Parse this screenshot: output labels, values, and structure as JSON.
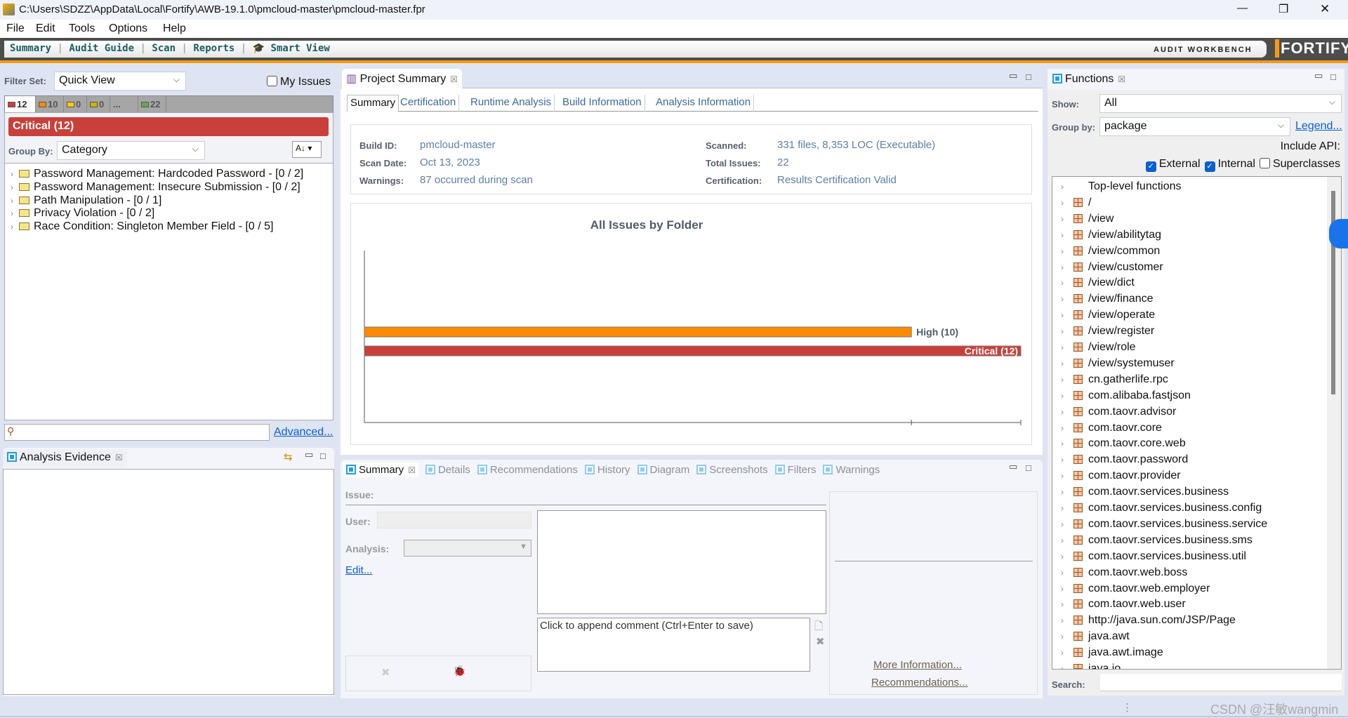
{
  "window": {
    "title": "C:\\Users\\SDZZ\\AppData\\Local\\Fortify\\AWB-19.1.0\\pmcloud-master\\pmcloud-master.fpr",
    "minimize": "—",
    "restore": "❐",
    "close": "✕"
  },
  "menu": [
    "File",
    "Edit",
    "Tools",
    "Options",
    "Help"
  ],
  "toolbar": {
    "items": [
      "Summary",
      "Audit Guide",
      "Scan",
      "Reports",
      "Smart View"
    ],
    "brand_text": "AUDIT WORKBENCH",
    "logo": "FORTIFY"
  },
  "left": {
    "filter_set_label": "Filter Set:",
    "filter_set_value": "Quick View",
    "my_issues": "My Issues",
    "severity_tabs": [
      {
        "count": "12",
        "color": "#c9403a"
      },
      {
        "count": "10",
        "color": "#ff8a00"
      },
      {
        "count": "0",
        "color": "#ffcc00"
      },
      {
        "count": "0",
        "color": "#d4b000"
      },
      {
        "count": "...",
        "color": ""
      },
      {
        "count": "22",
        "color": "#6aa84f"
      }
    ],
    "critical_label": "Critical (12)",
    "group_by_label": "Group By:",
    "group_by_value": "Category",
    "tree": [
      "Password Management: Hardcoded Password - [0 / 2]",
      "Password Management: Insecure Submission - [0 / 2]",
      "Path Manipulation - [0 / 1]",
      "Privacy Violation - [0 / 2]",
      "Race Condition: Singleton Member Field - [0 / 5]"
    ],
    "search_value": "",
    "advanced": "Advanced...",
    "evidence_title": "Analysis Evidence"
  },
  "project": {
    "tab_title": "Project Summary",
    "subtabs": [
      "Summary",
      "Certification",
      "Runtime Analysis",
      "Build Information",
      "Analysis Information"
    ],
    "info": {
      "build_id_label": "Build ID:",
      "build_id": "pmcloud-master",
      "scan_date_label": "Scan Date:",
      "scan_date": "Oct 13, 2023",
      "warnings_label": "Warnings:",
      "warnings": "87 occurred during scan",
      "scanned_label": "Scanned:",
      "scanned": "331 files, 8,353 LOC (Executable)",
      "total_label": "Total Issues:",
      "total": "22",
      "cert_label": "Certification:",
      "cert": "Results Certification Valid"
    }
  },
  "chart_data": {
    "type": "bar",
    "orientation": "horizontal",
    "title": "All Issues by Folder",
    "categories": [
      "High",
      "Critical"
    ],
    "values": [
      10,
      12
    ],
    "labels": [
      "High (10)",
      "Critical (12)"
    ],
    "colors": [
      "#ff8a00",
      "#c9403a"
    ],
    "xlim": [
      0,
      12
    ],
    "xticks": [
      10,
      12
    ],
    "grid": false,
    "legend": "none"
  },
  "issue": {
    "tabs": [
      "Summary",
      "Details",
      "Recommendations",
      "History",
      "Diagram",
      "Screenshots",
      "Filters",
      "Warnings"
    ],
    "issue_label": "Issue:",
    "user_label": "User:",
    "analysis_label": "Analysis:",
    "edit": "Edit...",
    "comment_placeholder": "Click to append comment (Ctrl+Enter to save)",
    "more_info": "More Information...",
    "recommendations": "Recommendations..."
  },
  "functions": {
    "title": "Functions",
    "show_label": "Show:",
    "show_value": "All",
    "group_label": "Group by:",
    "group_value": "package",
    "legend": "Legend...",
    "include_api": "Include API:",
    "checks": [
      {
        "label": "External",
        "checked": true
      },
      {
        "label": "Internal",
        "checked": true
      },
      {
        "label": "Superclasses",
        "checked": false
      }
    ],
    "items": [
      "Top-level functions",
      "/",
      "/view",
      "/view/abilitytag",
      "/view/common",
      "/view/customer",
      "/view/dict",
      "/view/finance",
      "/view/operate",
      "/view/register",
      "/view/role",
      "/view/systemuser",
      "cn.gatherlife.rpc",
      "com.alibaba.fastjson",
      "com.taovr.advisor",
      "com.taovr.core",
      "com.taovr.core.web",
      "com.taovr.password",
      "com.taovr.provider",
      "com.taovr.services.business",
      "com.taovr.services.business.config",
      "com.taovr.services.business.service",
      "com.taovr.services.business.sms",
      "com.taovr.services.business.util",
      "com.taovr.web.boss",
      "com.taovr.web.employer",
      "com.taovr.web.user",
      "http://java.sun.com/JSP/Page",
      "java.awt",
      "java.awt.image",
      "java.io"
    ],
    "search_label": "Search:",
    "search_value": ""
  },
  "status": {
    "watermark": "CSDN @汪敏wangmin"
  }
}
